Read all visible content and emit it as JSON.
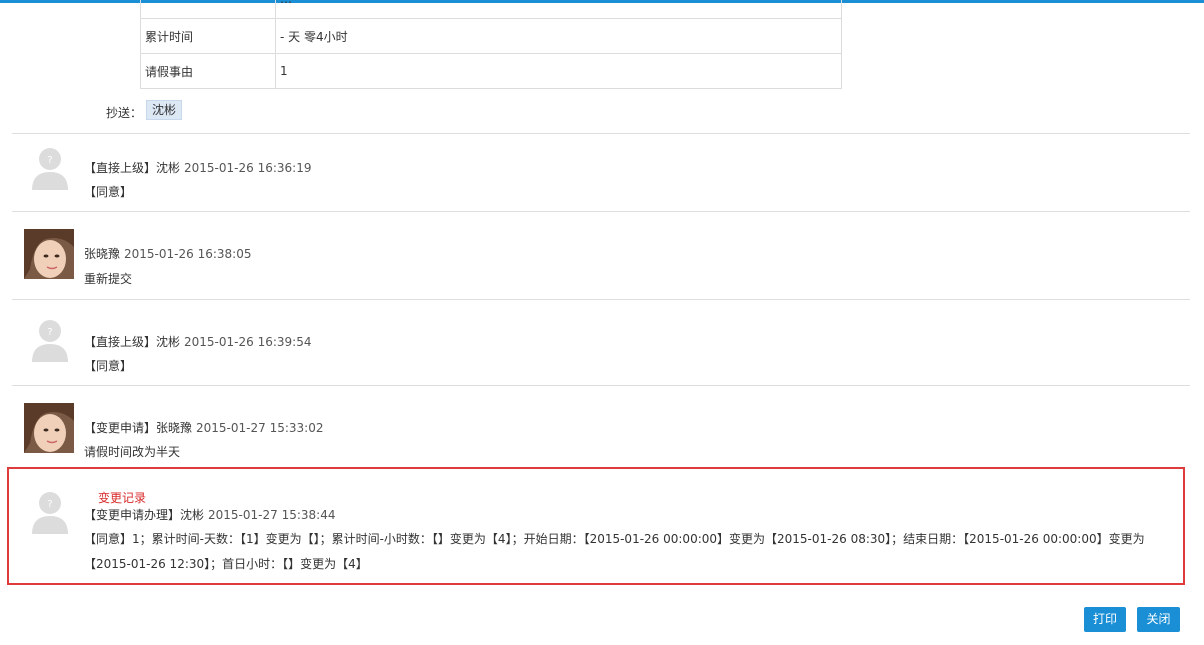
{
  "table": {
    "cut_row_value": "…",
    "rows": [
      {
        "label": "累计时间",
        "value": "- 天 零4小时"
      },
      {
        "label": "请假事由",
        "value": "1"
      }
    ]
  },
  "cc": {
    "label": "抄送：",
    "person": "沈彬"
  },
  "comments": [
    {
      "head": "【直接上级】沈彬",
      "time": "2015-01-26 16:36:19",
      "body": "【同意】"
    },
    {
      "head": "张晓豫",
      "time": "2015-01-26 16:38:05",
      "body": "重新提交"
    },
    {
      "head": "【直接上级】沈彬",
      "time": "2015-01-26 16:39:54",
      "body": "【同意】"
    },
    {
      "head": "【变更申请】张晓豫",
      "time": "2015-01-27 15:33:02",
      "body": "请假时间改为半天"
    }
  ],
  "change": {
    "tag": "变更记录",
    "head": "【变更申请办理】沈彬",
    "time": "2015-01-27 15:38:44",
    "body": "【同意】1；累计时间-天数：【1】变更为【】；累计时间-小时数：【】变更为【4】；开始日期：【2015-01-26 00:00:00】变更为【2015-01-26 08:30】；结束日期：【2015-01-26 00:00:00】变更为【2015-01-26 12:30】；首日小时：【】变更为【4】"
  },
  "buttons": {
    "print": "打印",
    "close": "关闭"
  },
  "colors": {
    "accent": "#1a8fd6",
    "highlight": "#e03b3b"
  }
}
